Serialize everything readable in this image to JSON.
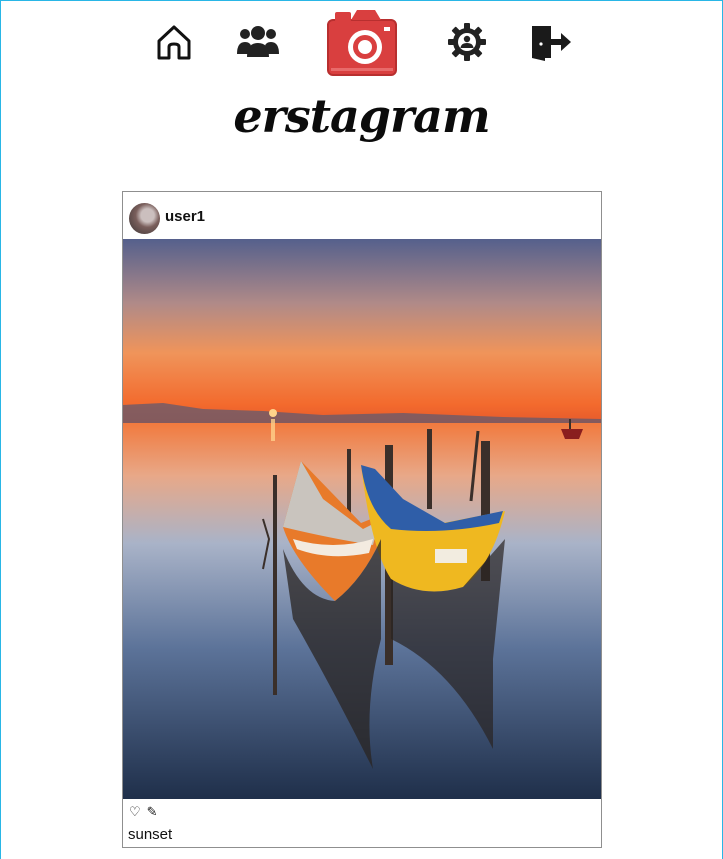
{
  "app": {
    "brand_text": "erstagram"
  },
  "nav": {
    "items": [
      {
        "icon": "home-icon"
      },
      {
        "icon": "friends-icon"
      },
      {
        "icon": "camera-icon",
        "accent": "#d93f3f"
      },
      {
        "icon": "settings-icon"
      },
      {
        "icon": "logout-icon"
      }
    ]
  },
  "post": {
    "username": "user1",
    "like_glyph": "♡",
    "edit_glyph": "✎",
    "caption": "sunset"
  },
  "colors": {
    "frame_border": "#29b6e6",
    "card_border": "#8f8f8f",
    "camera_red": "#d93f3f"
  }
}
